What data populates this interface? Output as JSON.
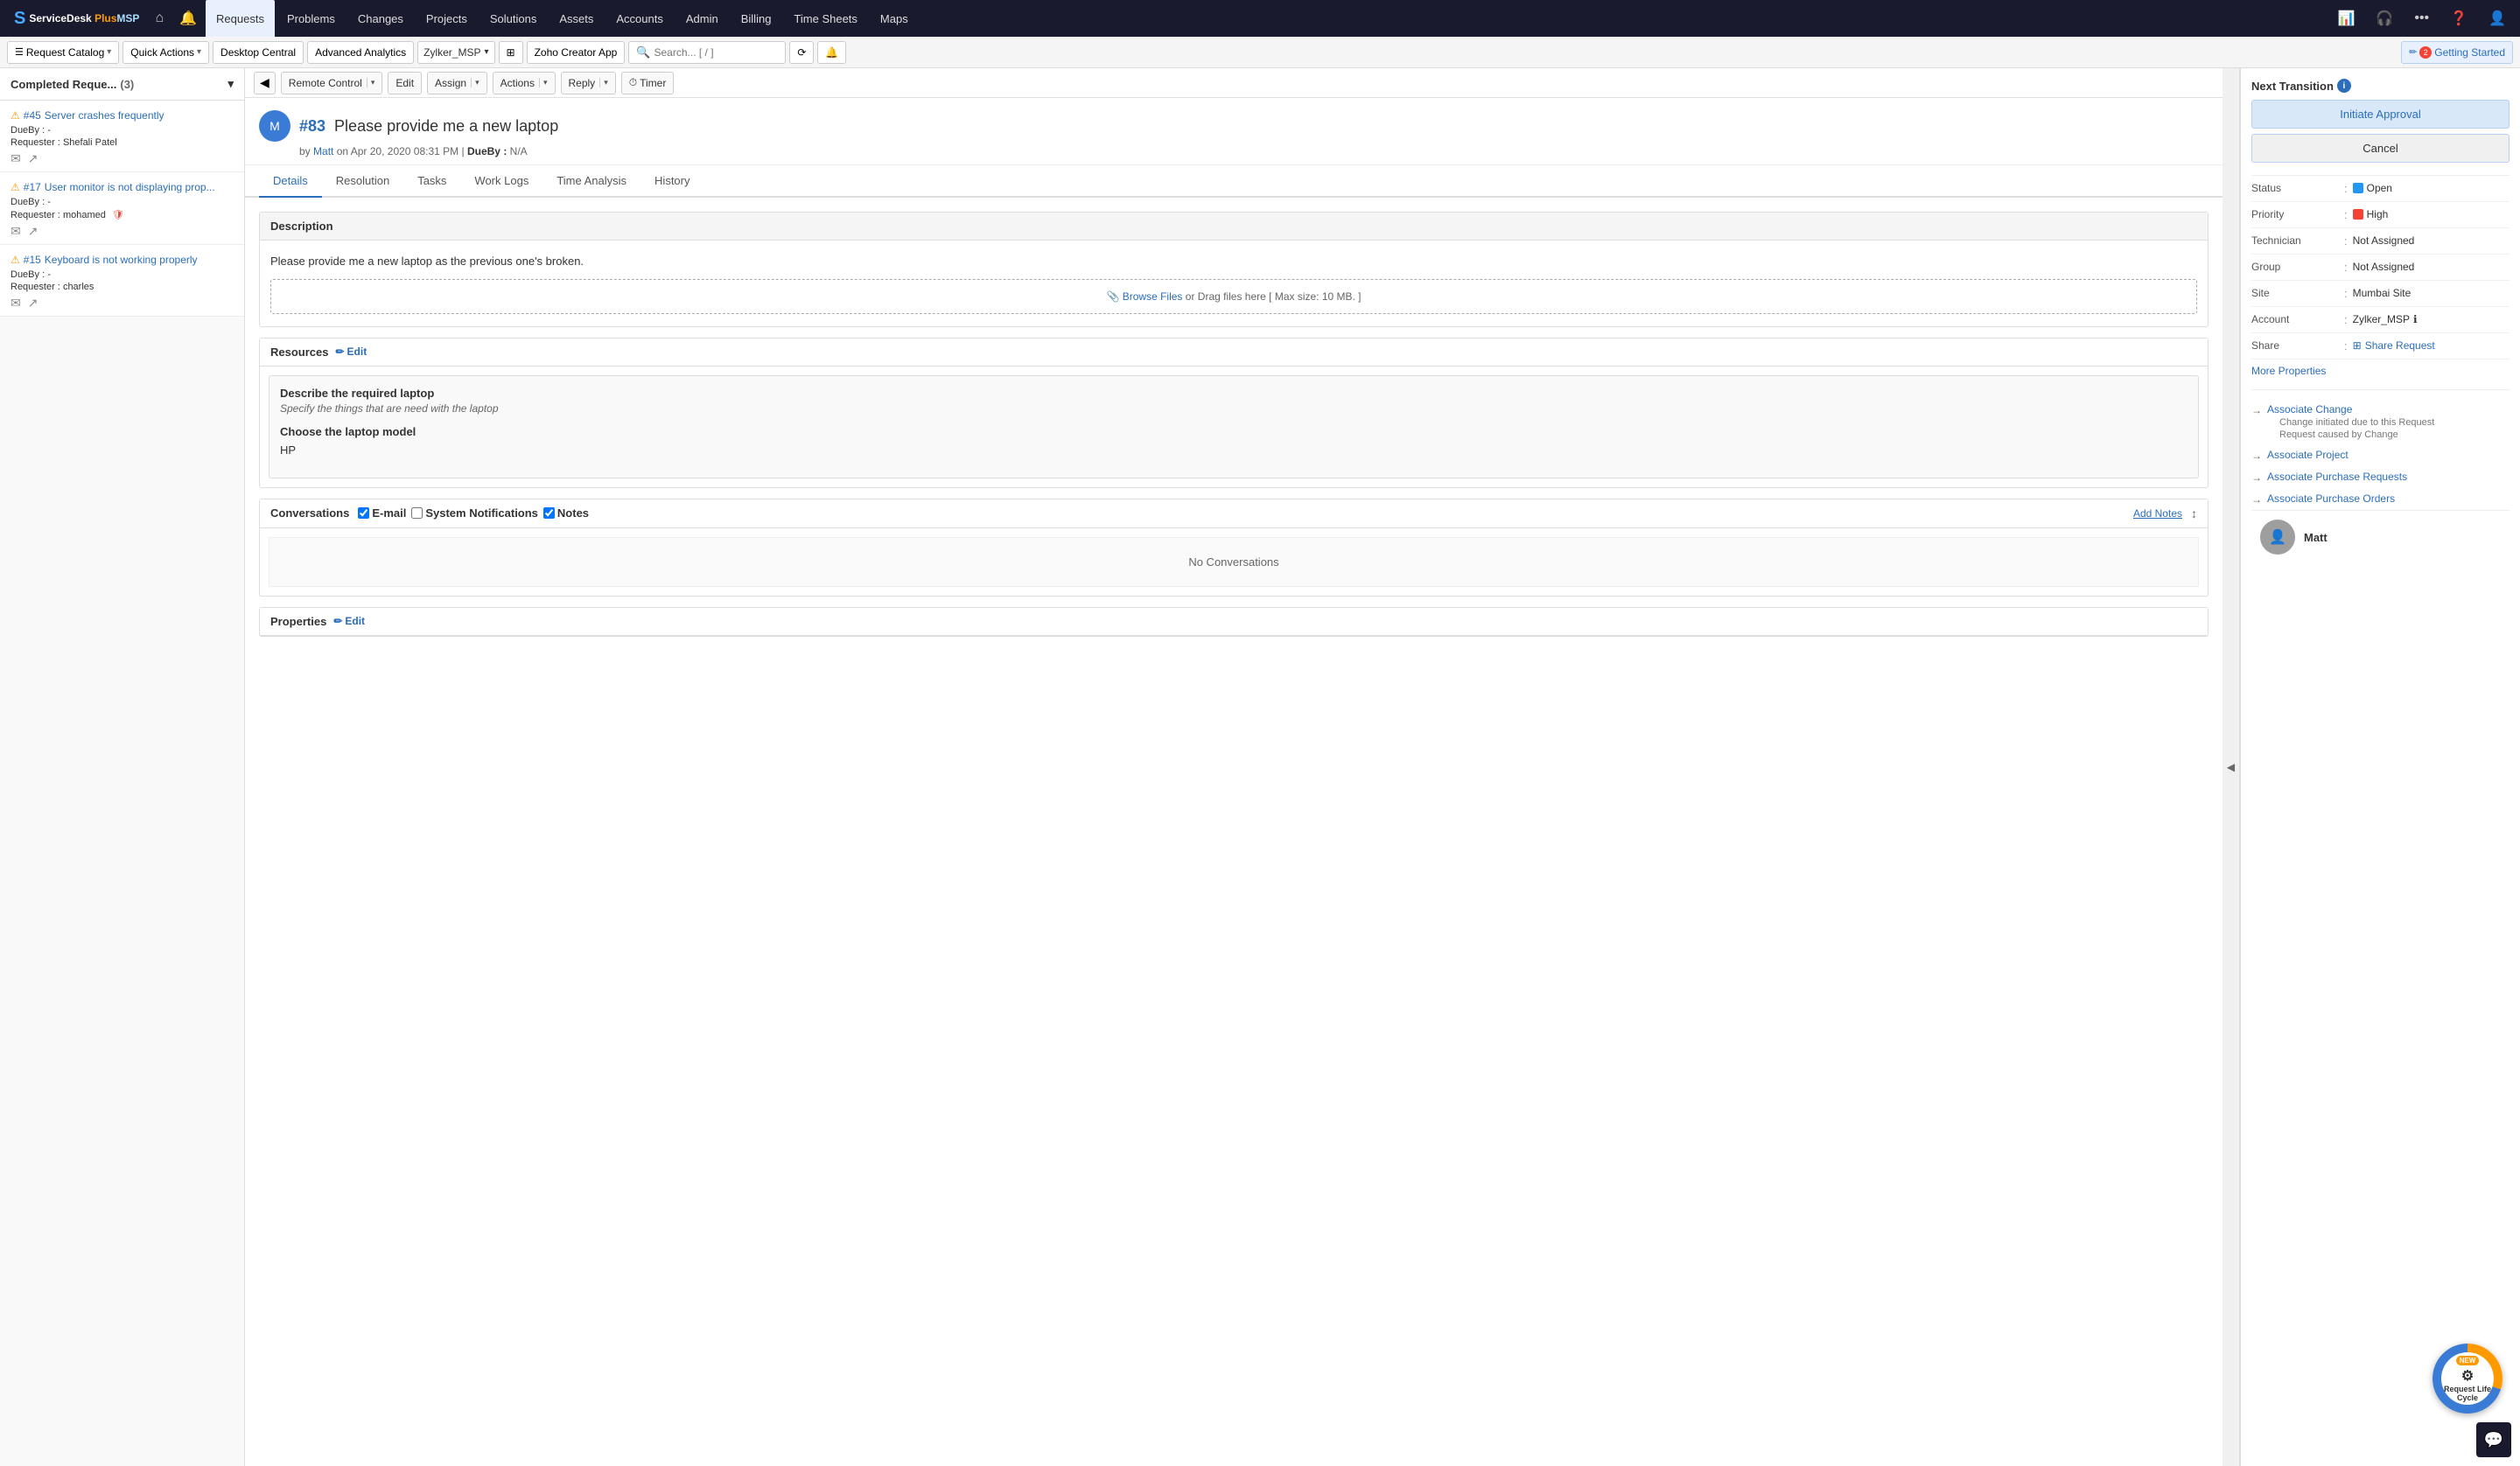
{
  "app": {
    "name": "ServiceDesk Plus MSP",
    "logo_text": "ServiceDesk",
    "plus": "Plus",
    "msp": "MSP"
  },
  "top_nav": {
    "items": [
      {
        "label": "Requests",
        "active": true
      },
      {
        "label": "Problems",
        "active": false
      },
      {
        "label": "Changes",
        "active": false
      },
      {
        "label": "Projects",
        "active": false
      },
      {
        "label": "Solutions",
        "active": false
      },
      {
        "label": "Assets",
        "active": false
      },
      {
        "label": "Accounts",
        "active": false
      },
      {
        "label": "Admin",
        "active": false
      },
      {
        "label": "Billing",
        "active": false
      },
      {
        "label": "Time Sheets",
        "active": false
      },
      {
        "label": "Maps",
        "active": false
      }
    ]
  },
  "toolbar": {
    "catalog": "Request Catalog",
    "quick_actions": "Quick Actions",
    "desktop_central": "Desktop Central",
    "advanced_analytics": "Advanced Analytics",
    "instance": "Zylker_MSP",
    "zoho_creator": "Zoho Creator App",
    "search_placeholder": "Search... [ / ]",
    "getting_started": "Getting Started"
  },
  "sub_toolbar": {
    "remote_control": "Remote Control",
    "edit": "Edit",
    "assign": "Assign",
    "actions": "Actions",
    "reply": "Reply",
    "timer": "Timer"
  },
  "left_panel": {
    "header": "Completed Reque...",
    "count": "(3)",
    "tickets": [
      {
        "id": "#45",
        "title": "Server crashes frequently",
        "due_label": "DueBy :",
        "due_val": "-",
        "req_label": "Requester :",
        "req_val": "Shefali Patel"
      },
      {
        "id": "#17",
        "title": "User monitor is not displaying prop...",
        "due_label": "DueBy :",
        "due_val": "-",
        "req_label": "Requester :",
        "req_val": "mohamed"
      },
      {
        "id": "#15",
        "title": "Keyboard is not working properly",
        "due_label": "DueBy :",
        "due_val": "-",
        "req_label": "Requester :",
        "req_val": "charles"
      }
    ]
  },
  "request": {
    "number": "#83",
    "subject": "Please provide me a new laptop",
    "by_label": "by",
    "author": "Matt",
    "date": "Apr 20, 2020 08:31 PM",
    "due_label": "DueBy :",
    "due_val": "N/A"
  },
  "tabs": [
    {
      "label": "Details",
      "active": true
    },
    {
      "label": "Resolution",
      "active": false
    },
    {
      "label": "Tasks",
      "active": false
    },
    {
      "label": "Work Logs",
      "active": false
    },
    {
      "label": "Time Analysis",
      "active": false
    },
    {
      "label": "History",
      "active": false
    }
  ],
  "description": {
    "header": "Description",
    "text": "Please provide me a new laptop as the previous one's broken.",
    "file_browse": "Browse Files",
    "file_text": "or Drag files here [ Max size: 10 MB. ]"
  },
  "resources": {
    "header": "Resources",
    "edit_label": "Edit",
    "field1_label": "Describe the required laptop",
    "field1_sublabel": "Specify the things that are need with the laptop",
    "field2_label": "Choose the laptop model",
    "field2_value": "HP"
  },
  "conversations": {
    "header": "Conversations",
    "email_label": "E-mail",
    "email_checked": true,
    "sys_notif_label": "System Notifications",
    "sys_notif_checked": false,
    "notes_label": "Notes",
    "notes_checked": true,
    "add_notes": "Add Notes",
    "no_conv": "No Conversations"
  },
  "properties": {
    "header": "Properties",
    "edit_label": "Edit"
  },
  "right_panel": {
    "next_transition_label": "Next Transition",
    "initiate_approval": "Initiate Approval",
    "cancel": "Cancel",
    "props": [
      {
        "key": "Status",
        "val": "Open",
        "type": "status_open"
      },
      {
        "key": "Priority",
        "val": "High",
        "type": "status_high"
      },
      {
        "key": "Technician",
        "val": "Not Assigned",
        "type": "text"
      },
      {
        "key": "Group",
        "val": "Not Assigned",
        "type": "text"
      },
      {
        "key": "Site",
        "val": "Mumbai Site",
        "type": "text"
      },
      {
        "key": "Account",
        "val": "Zylker_MSP",
        "type": "account"
      },
      {
        "key": "Share",
        "val": "Share Request",
        "type": "share"
      }
    ],
    "more_properties": "More Properties",
    "associations": [
      {
        "label": "Associate Change",
        "sub1": "Change initiated due to this Request",
        "sub2": "Request caused by Change"
      },
      {
        "label": "Associate Project",
        "sub1": "",
        "sub2": ""
      },
      {
        "label": "Associate Purchase Requests",
        "sub1": "",
        "sub2": ""
      },
      {
        "label": "Associate Purchase Orders",
        "sub1": "",
        "sub2": ""
      }
    ],
    "requester_name": "Matt"
  },
  "lifecycle": {
    "new_label": "NEW",
    "label": "Request Life Cycle"
  }
}
